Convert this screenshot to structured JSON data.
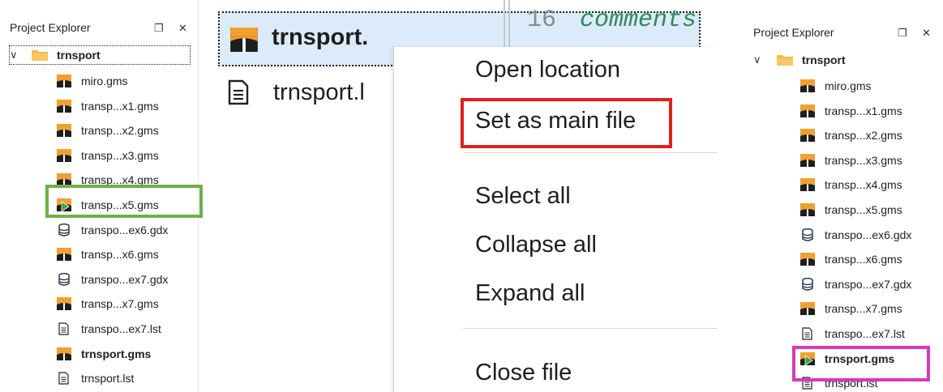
{
  "left_explorer": {
    "title": "Project Explorer",
    "float_button": "❐",
    "close_button": "✕",
    "project": {
      "name": "trnsport",
      "expanded": true
    },
    "items": [
      {
        "label": "miro.gms",
        "icon": "gams-file-icon",
        "bold": false
      },
      {
        "label": "transp...x1.gms",
        "icon": "gams-file-icon",
        "bold": false
      },
      {
        "label": "transp...x2.gms",
        "icon": "gams-file-icon",
        "bold": false
      },
      {
        "label": "transp...x3.gms",
        "icon": "gams-file-icon",
        "bold": false
      },
      {
        "label": "transp...x4.gms",
        "icon": "gams-file-icon",
        "bold": false
      },
      {
        "label": "transp...x5.gms",
        "icon": "gams-main-file-icon",
        "bold": false
      },
      {
        "label": "transpo...ex6.gdx",
        "icon": "gdx-file-icon",
        "bold": false
      },
      {
        "label": "transp...x6.gms",
        "icon": "gams-file-icon",
        "bold": false
      },
      {
        "label": "transpo...ex7.gdx",
        "icon": "gdx-file-icon",
        "bold": false
      },
      {
        "label": "transp...x7.gms",
        "icon": "gams-file-icon",
        "bold": false
      },
      {
        "label": "transpo...ex7.lst",
        "icon": "lst-file-icon",
        "bold": false
      },
      {
        "label": "trnsport.gms",
        "icon": "gams-file-icon",
        "bold": true
      },
      {
        "label": "trnsport.lst",
        "icon": "lst-file-icon",
        "bold": false
      }
    ]
  },
  "middle": {
    "selected_item": {
      "label": "trnsport.",
      "icon": "gams-file-icon"
    },
    "second_item": {
      "label": "trnsport.l",
      "icon": "lst-file-icon"
    },
    "editor": {
      "line_number": "16",
      "code_fragment": "comments"
    },
    "context_menu": {
      "groups": [
        [
          "Open location",
          "Set as main file"
        ],
        [
          "Select all",
          "Collapse all",
          "Expand all"
        ],
        [
          "Close file"
        ]
      ],
      "highlighted": "Set as main file"
    }
  },
  "right_explorer": {
    "title": "Project Explorer",
    "float_button": "❐",
    "close_button": "✕",
    "project": {
      "name": "trnsport",
      "expanded": true
    },
    "items": [
      {
        "label": "miro.gms",
        "icon": "gams-file-icon",
        "bold": false
      },
      {
        "label": "transp...x1.gms",
        "icon": "gams-file-icon",
        "bold": false
      },
      {
        "label": "transp...x2.gms",
        "icon": "gams-file-icon",
        "bold": false
      },
      {
        "label": "transp...x3.gms",
        "icon": "gams-file-icon",
        "bold": false
      },
      {
        "label": "transp...x4.gms",
        "icon": "gams-file-icon",
        "bold": false
      },
      {
        "label": "transp...x5.gms",
        "icon": "gams-file-icon",
        "bold": false
      },
      {
        "label": "transpo...ex6.gdx",
        "icon": "gdx-file-icon",
        "bold": false
      },
      {
        "label": "transp...x6.gms",
        "icon": "gams-file-icon",
        "bold": false
      },
      {
        "label": "transpo...ex7.gdx",
        "icon": "gdx-file-icon",
        "bold": false
      },
      {
        "label": "transp...x7.gms",
        "icon": "gams-file-icon",
        "bold": false
      },
      {
        "label": "transpo...ex7.lst",
        "icon": "lst-file-icon",
        "bold": false
      },
      {
        "label": "trnsport.gms",
        "icon": "gams-main-file-icon",
        "bold": true
      },
      {
        "label": "trnsport.lst",
        "icon": "lst-file-icon",
        "bold": false
      }
    ]
  },
  "colors": {
    "gams_orange": "#f0a030",
    "gams_dark": "#1e1e1e",
    "main_play": "#3aa935",
    "folder": "#f5b94a",
    "selection_bg": "#dcebfa",
    "highlight_green": "#6fb04a",
    "highlight_red": "#e0201c",
    "highlight_magenta": "#d63ab8"
  }
}
